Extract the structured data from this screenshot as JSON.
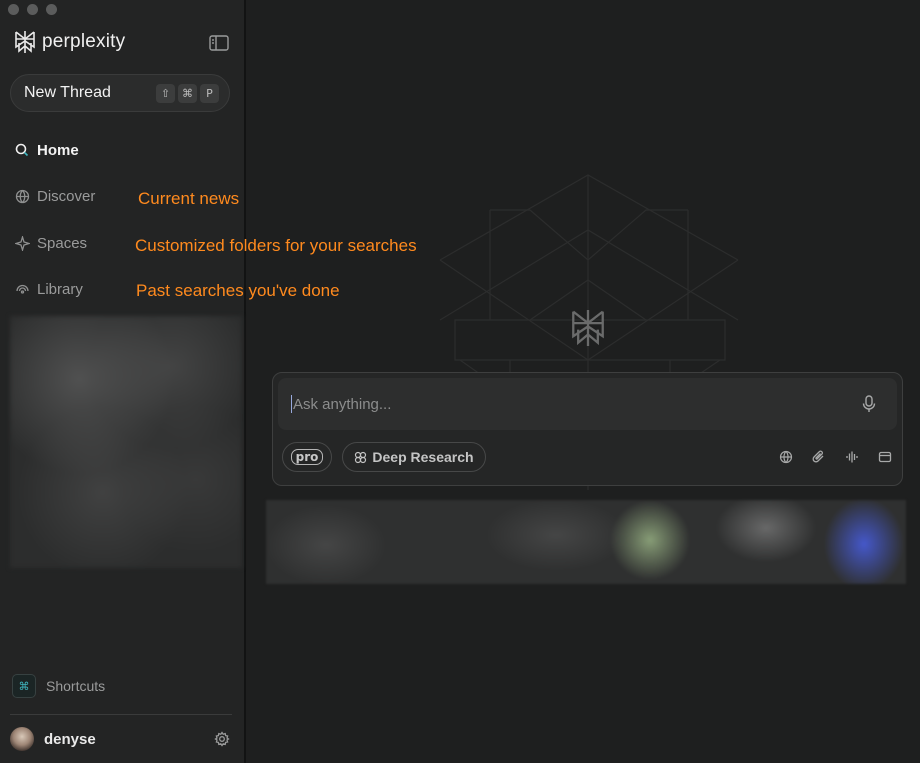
{
  "app": {
    "brand": "perplexity"
  },
  "sidebar": {
    "new_thread": {
      "label": "New Thread",
      "keys": [
        "⇧",
        "⌘",
        "P"
      ]
    },
    "items": [
      {
        "label": "Home",
        "icon": "search-icon",
        "active": true
      },
      {
        "label": "Discover",
        "icon": "globe-icon"
      },
      {
        "label": "Spaces",
        "icon": "sparkle-icon"
      },
      {
        "label": "Library",
        "icon": "library-icon"
      }
    ],
    "shortcuts": {
      "label": "Shortcuts",
      "icon_glyph": "⌘"
    },
    "user": {
      "name": "denyse"
    }
  },
  "annotations": [
    "Current news",
    "Customized folders for your searches",
    "Past searches you've done"
  ],
  "composer": {
    "placeholder": "Ask anything...",
    "pro_label": "pro",
    "deep_research_label": "Deep Research"
  },
  "colors": {
    "annotation": "#ff8a1e",
    "accent": "#3fb7c0",
    "background": "#1e1f1f"
  }
}
